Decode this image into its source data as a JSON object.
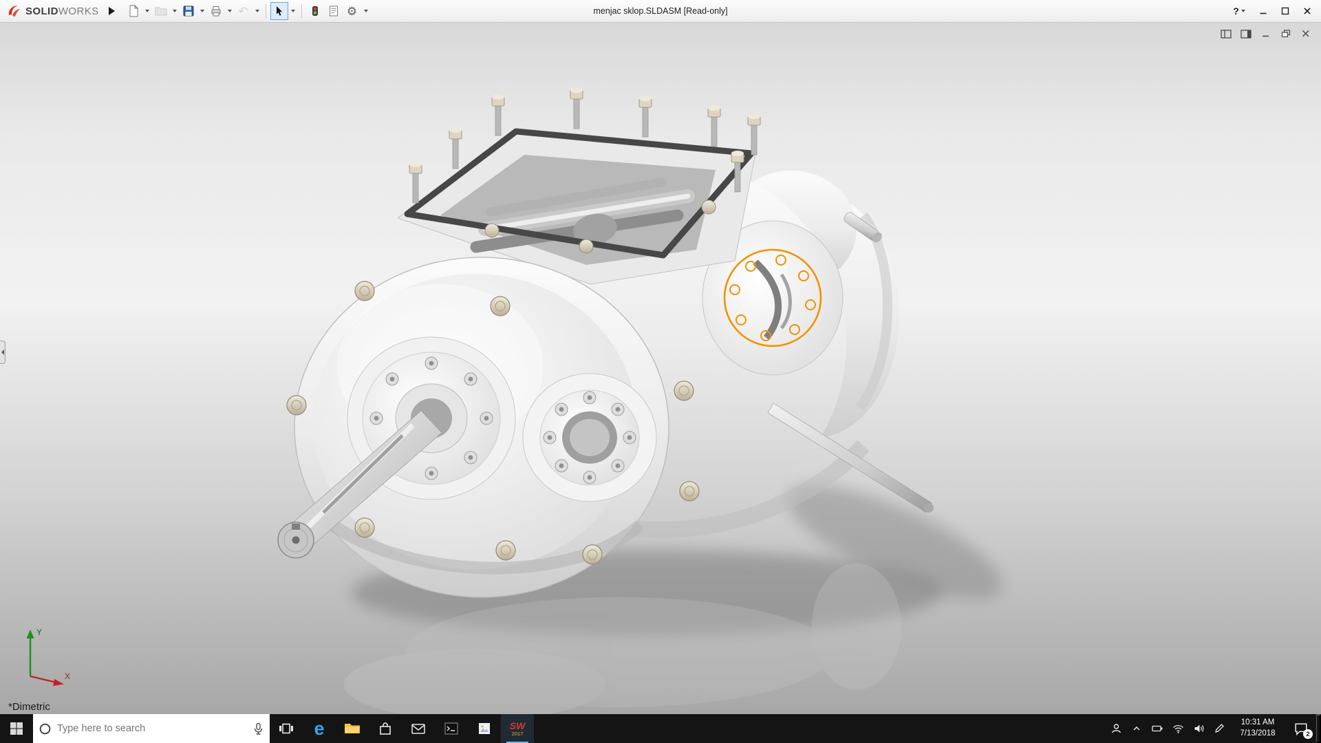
{
  "window": {
    "brand_bold": "SOLID",
    "brand_light": "WORKS",
    "title": "menjac sklop.SLDASM [Read-only]",
    "help_label": "?"
  },
  "toolbar": {
    "icons": [
      "new-document",
      "open-folder",
      "save",
      "print",
      "undo",
      "select-arrow",
      "rebuild",
      "file-properties",
      "options-gear"
    ],
    "disabled_icons": [
      "open-folder",
      "undo"
    ],
    "active_tool": "select-arrow"
  },
  "document_window": {
    "control_icons": [
      "pane-dock",
      "pane-preview",
      "minimize",
      "restore",
      "close"
    ]
  },
  "viewport": {
    "orientation_label": "*Dimetric",
    "triad": {
      "x_label": "X",
      "y_label": "Y"
    },
    "selection_color": "#f09200",
    "highlighted_feature": "bearing-cover-bolt-circle"
  },
  "taskbar": {
    "search_placeholder": "Type here to search",
    "pinned_icons": [
      "task-view",
      "edge",
      "file-explorer",
      "store",
      "mail",
      "command-prompt",
      "photos",
      "solidworks-2017"
    ],
    "tray_icons": [
      "people",
      "hidden-icons-chevron",
      "battery",
      "network",
      "volume",
      "pen"
    ],
    "solidworks_app": {
      "label": "SW",
      "year": "2017"
    },
    "clock": {
      "time": "10:31 AM",
      "date": "7/13/2018"
    },
    "action_center_badge": "2"
  }
}
